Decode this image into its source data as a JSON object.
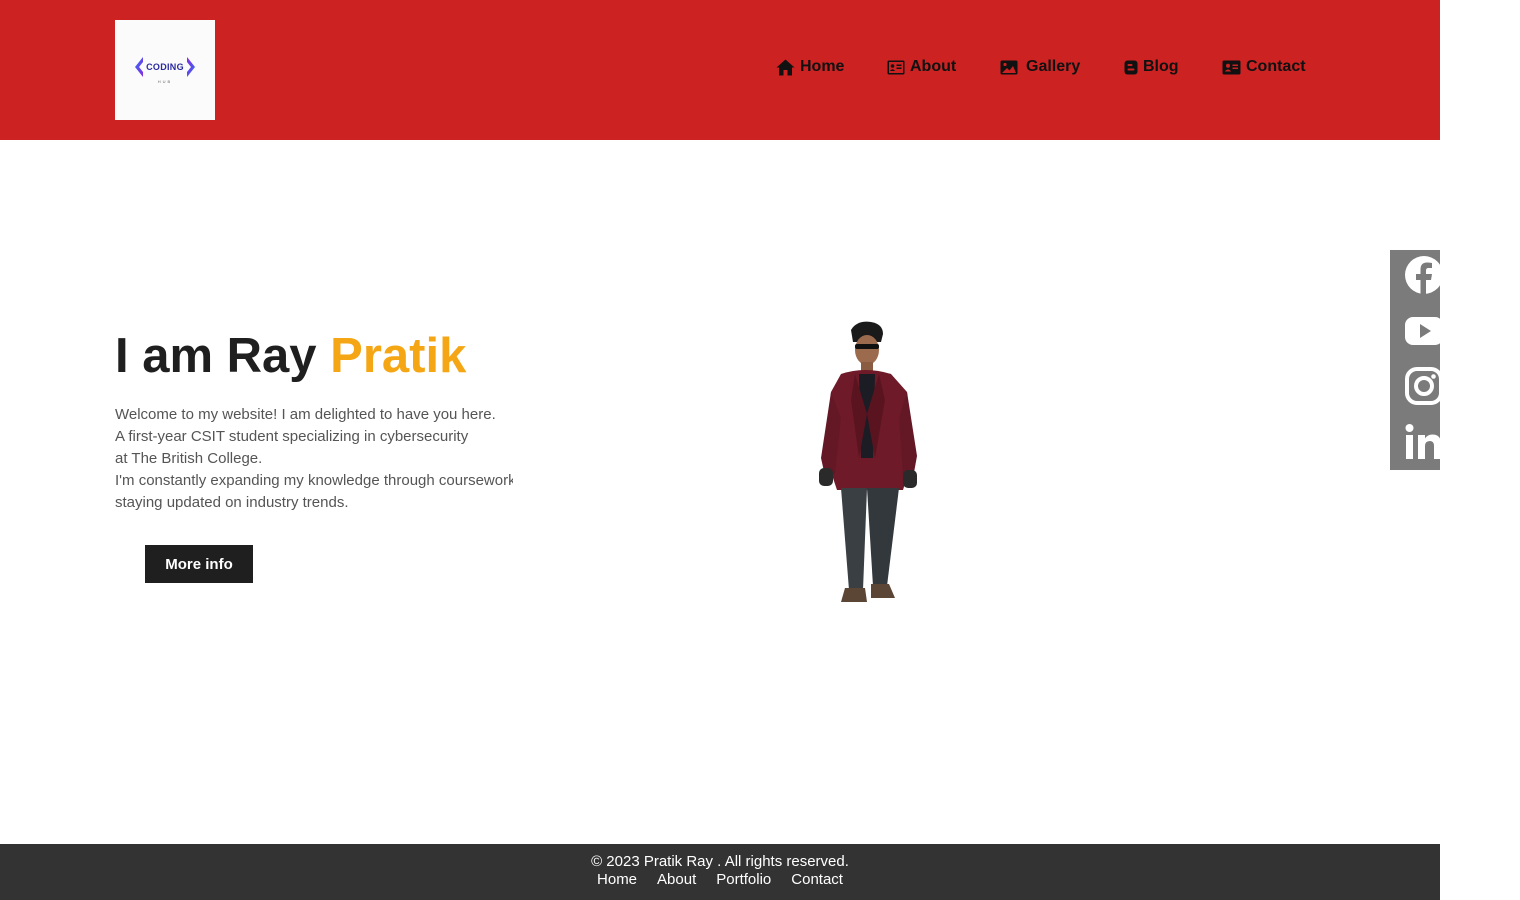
{
  "logo": {
    "word": "CODING",
    "sub": "HUB",
    "icon": "code-brackets-logo"
  },
  "nav": {
    "items": [
      {
        "label": "Home",
        "icon": "house-icon"
      },
      {
        "label": "About",
        "icon": "id-card-icon"
      },
      {
        "label": "Gallery",
        "icon": "image-icon"
      },
      {
        "label": "Blog",
        "icon": "blogger-icon"
      },
      {
        "label": "Contact",
        "icon": "contact-card-icon"
      }
    ]
  },
  "hero": {
    "title_prefix": "I am Ray ",
    "title_accent": "Pratik",
    "lines": [
      "Welcome to my website! I am delighted to have you here.",
      "A first-year CSIT student specializing in cybersecurity",
      "at The British College.",
      "I'm constantly expanding my knowledge through coursework and",
      "staying updated on industry trends."
    ],
    "button_label": "More info",
    "image": "person-walking-photo"
  },
  "social": {
    "items": [
      {
        "icon": "facebook-icon"
      },
      {
        "icon": "youtube-icon"
      },
      {
        "icon": "instagram-icon"
      },
      {
        "icon": "linkedin-icon"
      }
    ]
  },
  "footer": {
    "copyright": "© 2023 Pratik Ray . All rights reserved.",
    "links": [
      "Home",
      "About",
      "Portfolio",
      "Contact"
    ]
  },
  "colors": {
    "header_bg": "#cc2222",
    "accent": "#f5a614",
    "dark": "#1f1f1f",
    "social_bg": "#7b7b7b",
    "footer_bg": "#333333"
  }
}
